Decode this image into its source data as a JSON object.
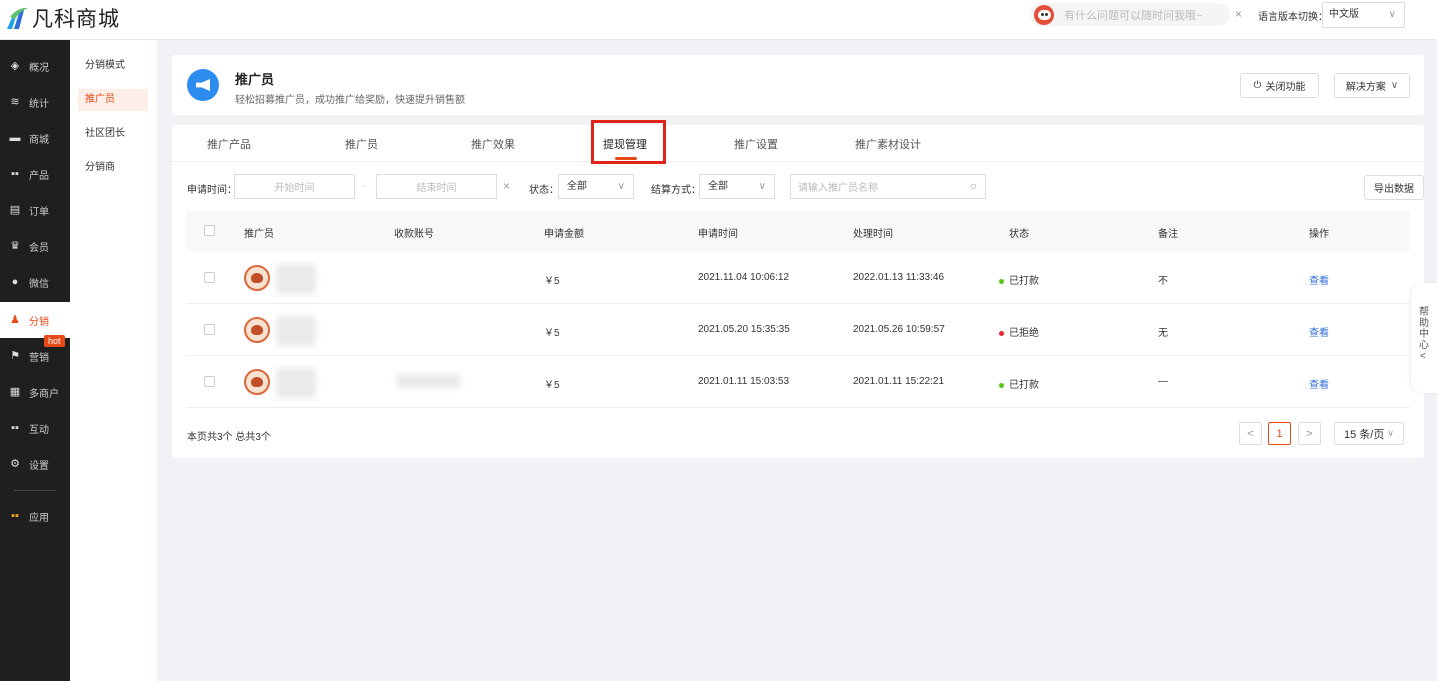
{
  "app": {
    "logo_text": "凡科商城"
  },
  "topbar": {
    "search_placeholder": "有什么问题可以随时问我哦~",
    "close_symbol": "×",
    "lang_label": "语言版本切换：",
    "lang_value": "中文版"
  },
  "nav": {
    "items": [
      {
        "label": "概况",
        "icon": "layers-icon"
      },
      {
        "label": "统计",
        "icon": "chart-icon"
      },
      {
        "label": "商城",
        "icon": "store-icon"
      },
      {
        "label": "产品",
        "icon": "grid-icon"
      },
      {
        "label": "订单",
        "icon": "clipboard-icon"
      },
      {
        "label": "会员",
        "icon": "crown-icon"
      },
      {
        "label": "微信",
        "icon": "chat-icon"
      },
      {
        "label": "分销",
        "icon": "people-icon"
      },
      {
        "label": "营销",
        "icon": "flag-icon"
      },
      {
        "label": "多商户",
        "icon": "shop-icon"
      },
      {
        "label": "互动",
        "icon": "apps-icon"
      },
      {
        "label": "设置",
        "icon": "gear-icon"
      },
      {
        "label": "应用",
        "icon": "app-tiles-icon"
      }
    ],
    "hot_badge": "hot"
  },
  "subnav": {
    "items": [
      "分销模式",
      "推广员",
      "社区团长",
      "分销商"
    ]
  },
  "header": {
    "title": "推广员",
    "subtitle": "轻松招募推广员，成功推广给奖励，快速提升销售额",
    "close_feature": "关闭功能",
    "solution": "解决方案"
  },
  "tabs": [
    "推广产品",
    "推广员",
    "推广效果",
    "提现管理",
    "推广设置",
    "推广素材设计"
  ],
  "filters": {
    "apply_time_label": "申请时间：",
    "start_placeholder": "开始时间",
    "range_sep": "-",
    "end_placeholder": "结束时间",
    "clear_symbol": "×",
    "status_label": "状态：",
    "status_value": "全部",
    "settle_label": "结算方式：",
    "settle_value": "全部",
    "name_placeholder": "请输入推广员名称",
    "export_label": "导出数据"
  },
  "table": {
    "headers": [
      "推广员",
      "收款账号",
      "申请金额",
      "申请时间",
      "处理时间",
      "状态",
      "备注",
      "操作"
    ],
    "rows": [
      {
        "amount": "￥5",
        "apply_time": "2021.11.04 10:06:12",
        "process_time": "2022.01.13 11:33:46",
        "status": "已打款",
        "status_color": "#52c41a",
        "note": "不",
        "action": "查看"
      },
      {
        "amount": "￥5",
        "apply_time": "2021.05.20 15:35:35",
        "process_time": "2021.05.26 10:59:57",
        "status": "已拒绝",
        "status_color": "#f5222d",
        "note": "无",
        "action": "查看"
      },
      {
        "amount": "￥5",
        "apply_time": "2021.01.11 15:03:53",
        "process_time": "2021.01.11 15:22:21",
        "status": "已打款",
        "status_color": "#52c41a",
        "note": "—",
        "action": "查看"
      }
    ]
  },
  "footer": {
    "summary": "本页共3个 总共3个",
    "prev": "<",
    "current_page": "1",
    "next": ">",
    "page_size": "15 条/页"
  },
  "help": {
    "label": "帮助中心",
    "chevron": "<"
  },
  "colors": {
    "accent": "#e64a19",
    "link": "#2d6fd6",
    "primary_blue": "#2d8cf0"
  }
}
